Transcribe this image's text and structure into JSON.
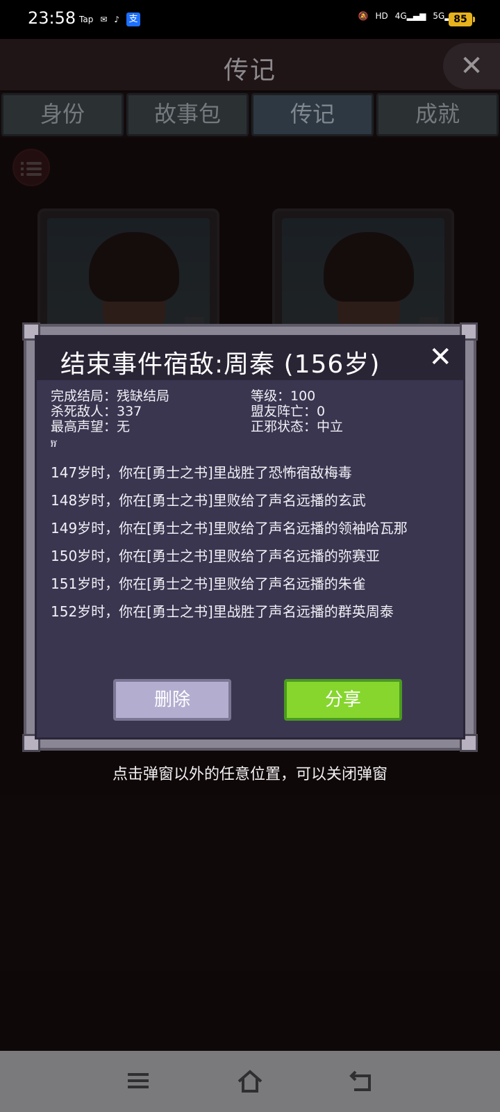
{
  "status": {
    "time": "23:58",
    "apps": [
      "Tap",
      "WeChat",
      "TikTok",
      "支"
    ],
    "battery": "85"
  },
  "header": {
    "title": "传记",
    "close_icon": "close-icon"
  },
  "tabs": [
    {
      "label": "身份"
    },
    {
      "label": "故事包"
    },
    {
      "label": "传记",
      "active": true
    },
    {
      "label": "成就"
    }
  ],
  "dialog": {
    "title": "结束事件宿敌:周秦 (156岁)",
    "stats": {
      "ending": "完成结局：残缺结局",
      "level": "等级：100",
      "kills": "杀死敌人：337",
      "ally_deaths": "盟友阵亡：0",
      "reputation": "最高声望：无",
      "alignment": "正邪状态：中立"
    },
    "glyph": "ⷍ",
    "events": [
      "147岁时，你在[勇士之书]里战胜了恐怖宿敌梅毒",
      "148岁时，你在[勇士之书]里败给了声名远播的玄武",
      "149岁时，你在[勇士之书]里败给了声名远播的领袖哈瓦那",
      "150岁时，你在[勇士之书]里败给了声名远播的弥赛亚",
      "151岁时，你在[勇士之书]里败给了声名远播的朱雀",
      "152岁时，你在[勇士之书]里战胜了声名远播的群英周泰"
    ],
    "delete_label": "删除",
    "share_label": "分享"
  },
  "hint": "点击弹窗以外的任意位置，可以关闭弹窗",
  "colors": {
    "share": "#86d62e",
    "delete": "#b3aed0",
    "dialog_bg": "#3a3650"
  }
}
